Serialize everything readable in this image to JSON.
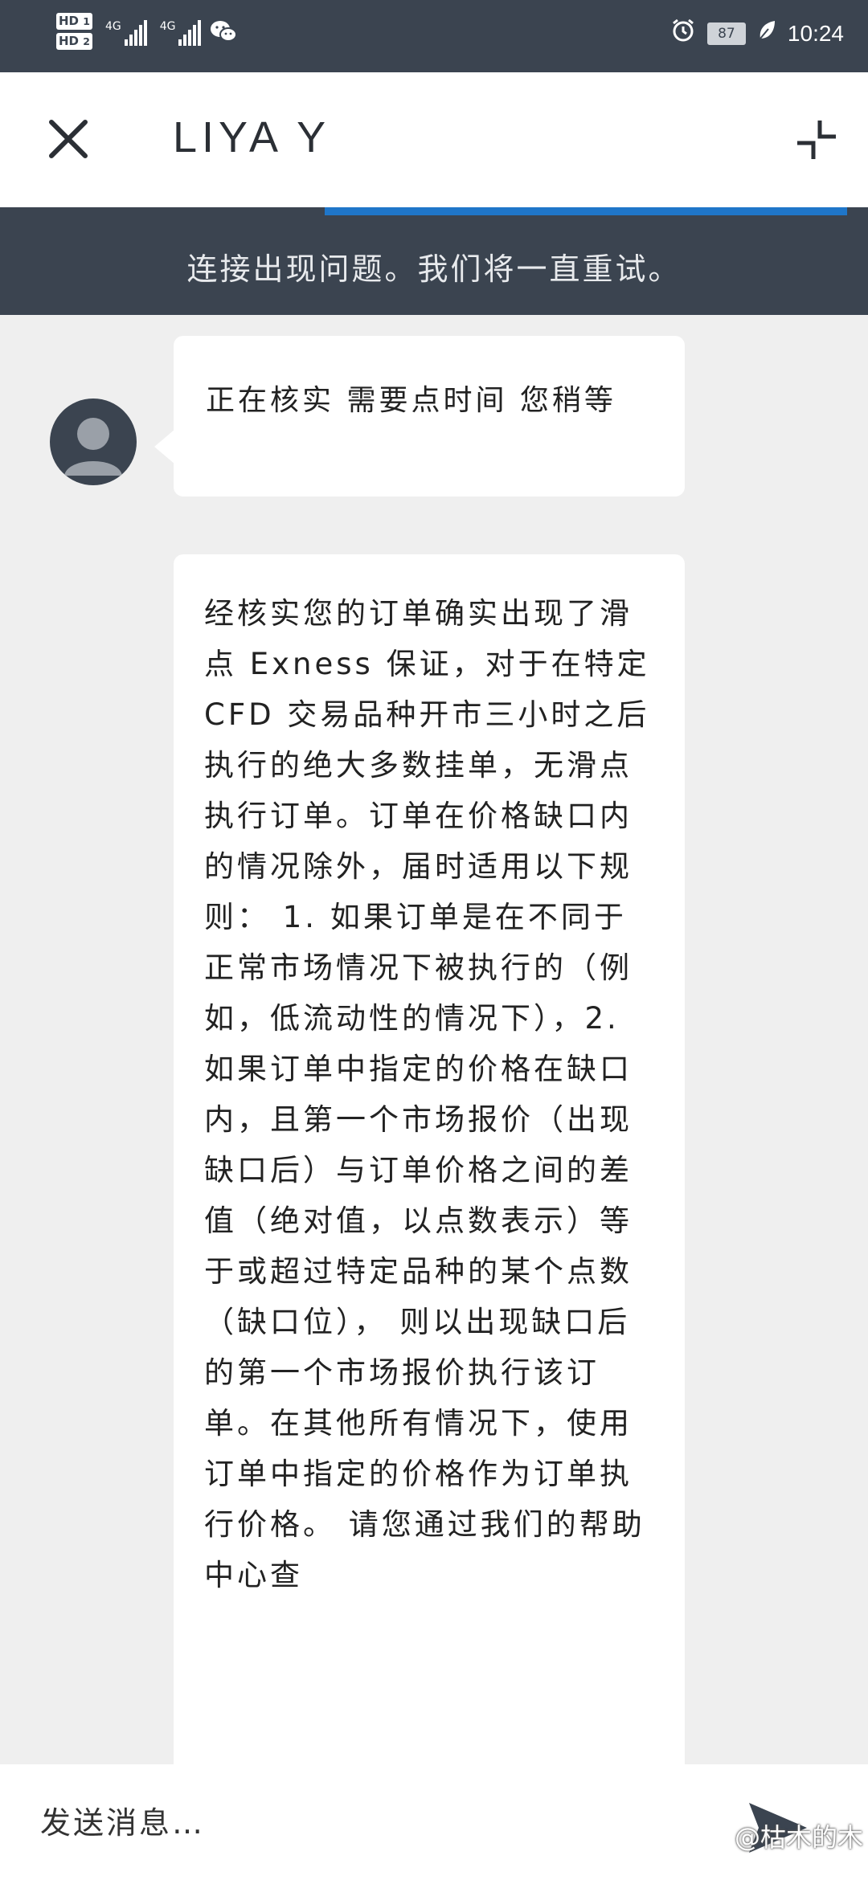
{
  "status_bar": {
    "sim1_label": "HD",
    "sim1_index": "1",
    "sim2_label": "HD",
    "sim2_index": "2",
    "network1": "4G",
    "network2": "4G",
    "battery": "87",
    "time": "10:24",
    "icons": [
      "wechat-icon",
      "alarm-icon",
      "leaf-icon"
    ]
  },
  "header": {
    "title": "LIYA Y",
    "close_icon": "close-icon",
    "collapse_icon": "collapse-icon"
  },
  "banner": {
    "text": "连接出现问题。我们将一直重试。",
    "progress_color": "#1f76c9"
  },
  "messages": [
    {
      "sender": "agent",
      "text": "正在核实 需要点时间 您稍等"
    },
    {
      "sender": "agent",
      "text": "经核实您的订单确实出现了滑点 Exness 保证，对于在特定 CFD 交易品种开市三小时之后执行的绝大多数挂单，无滑点执行订单。订单在价格缺口内的情况除外，届时适用以下规则： 1. 如果订单是在不同于正常市场情况下被执行的（例如，低流动性的情况下），2. 如果订单中指定的价格在缺口内，且第一个市场报价（出现缺口后）与订单价格之间的差值（绝对值，以点数表示）等于或超过特定品种的某个点数（缺口位）， 则以出现缺口后的第一个市场报价执行该订单。在其他所有情况下，使用订单中指定的价格作为订单执行价格。 请您通过我们的帮助中心查"
    }
  ],
  "compose": {
    "placeholder": "发送消息…",
    "send_icon": "send-icon"
  },
  "watermark": "@枯木的木",
  "colors": {
    "dark": "#3b4450",
    "background": "#efefef",
    "bubble": "#ffffff"
  }
}
